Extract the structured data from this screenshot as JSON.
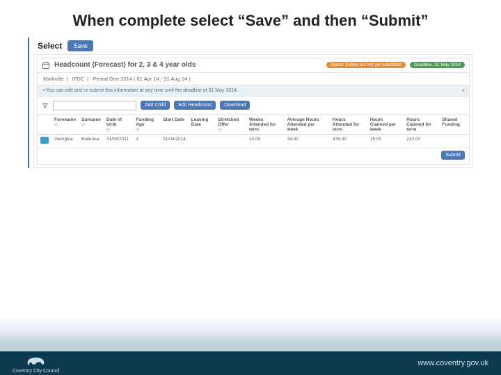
{
  "slide": {
    "title": "When complete select “Save” and then “Submit”"
  },
  "topbar": {
    "select_label": "Select",
    "save_label": "Save"
  },
  "panel": {
    "title": "Headcount (Forecast) for 2, 3 & 4 year olds",
    "status_pill": "Status: Edited but not yet submitted",
    "deadline_pill": "Deadline: 31 May 2014",
    "subheader": {
      "org": "Markville",
      "type": "IFDC",
      "period": "Period One 2014 ( 01 Apr 14 - 31 Aug 14 )"
    },
    "info_text": "• You can edit and re-submit this information at any time until the deadline of 31 May 2014."
  },
  "toolbar": {
    "add_child": "Add Child",
    "edit_headcount": "Edit Headcount",
    "download": "Download",
    "search_placeholder": ""
  },
  "table": {
    "headers": {
      "forename": "Forename",
      "surname": "Surname",
      "dob": "Date of birth",
      "funding_age": "Funding Age",
      "start_date": "Start Date",
      "leaving_date": "Leaving Date",
      "stretched_offer": "Stretched Offer",
      "weeks_attended": "Weeks Attended for term",
      "avg_hours": "Average Hours Attended per week",
      "hours_attended": "Hours Attended for term",
      "hours_claimed": "Hours Claimed per week",
      "hours_claimed_term": "Hours Claimed for term",
      "shared_funding": "Shared Funding"
    },
    "rows": [
      {
        "forename": "Georgina",
        "surname": "Ballerina",
        "dob": "31/03/2011",
        "funding_age": "3",
        "start_date": "01/04/2014",
        "leaving_date": "",
        "stretched_offer": "",
        "weeks_attended": "14.00",
        "avg_hours": "34.00",
        "hours_attended": "476.00",
        "hours_claimed": "15.00",
        "hours_claimed_term": "210.00",
        "shared_funding": ""
      }
    ]
  },
  "actions": {
    "submit": "Submit"
  },
  "footer": {
    "org": "Coventry City Council",
    "url": "www.coventry.gov.uk"
  }
}
